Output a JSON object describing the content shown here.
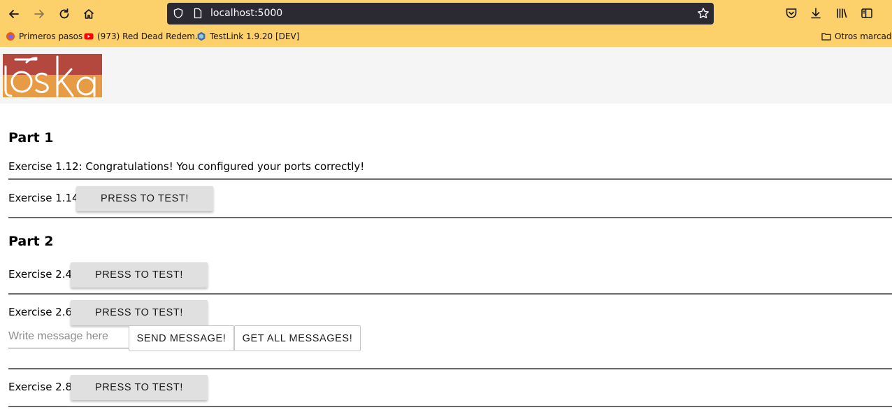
{
  "browser": {
    "url_host": "localhost",
    "url_port": ":5000",
    "bookmarks": [
      {
        "label": "Primeros pasos",
        "icon": "firefox-icon"
      },
      {
        "label": "(973) Red Dead Redem...",
        "icon": "youtube-icon"
      },
      {
        "label": "TestLink 1.9.20 [DEV]",
        "icon": "testlink-icon"
      }
    ],
    "other_bookmarks": "Otros marcador"
  },
  "page": {
    "logo_alt": "itoska",
    "part1": {
      "title": "Part 1",
      "ex_1_12": "Exercise 1.12: Congratulations! You configured your ports correctly!",
      "ex_1_14_label": "Exercise 1.14:",
      "ex_1_14_button": "PRESS TO TEST!"
    },
    "part2": {
      "title": "Part 2",
      "ex_2_4_label": "Exercise 2.4:",
      "ex_2_4_button": "PRESS TO TEST!",
      "ex_2_6_label": "Exercise 2.6:",
      "ex_2_6_button": "PRESS TO TEST!",
      "message_placeholder": "Write message here",
      "send_button": "SEND MESSAGE!",
      "get_all_button": "GET ALL MESSAGES!",
      "ex_2_8_label": "Exercise 2.8:",
      "ex_2_8_button": "PRESS TO TEST!"
    }
  },
  "colors": {
    "toolbar": "#fcd06b",
    "urlbar": "#2b2a33",
    "header": "#f5f5f5",
    "logo_dark": "#b5483e",
    "logo_light": "#e89b45",
    "button": "#e0e0e0"
  }
}
